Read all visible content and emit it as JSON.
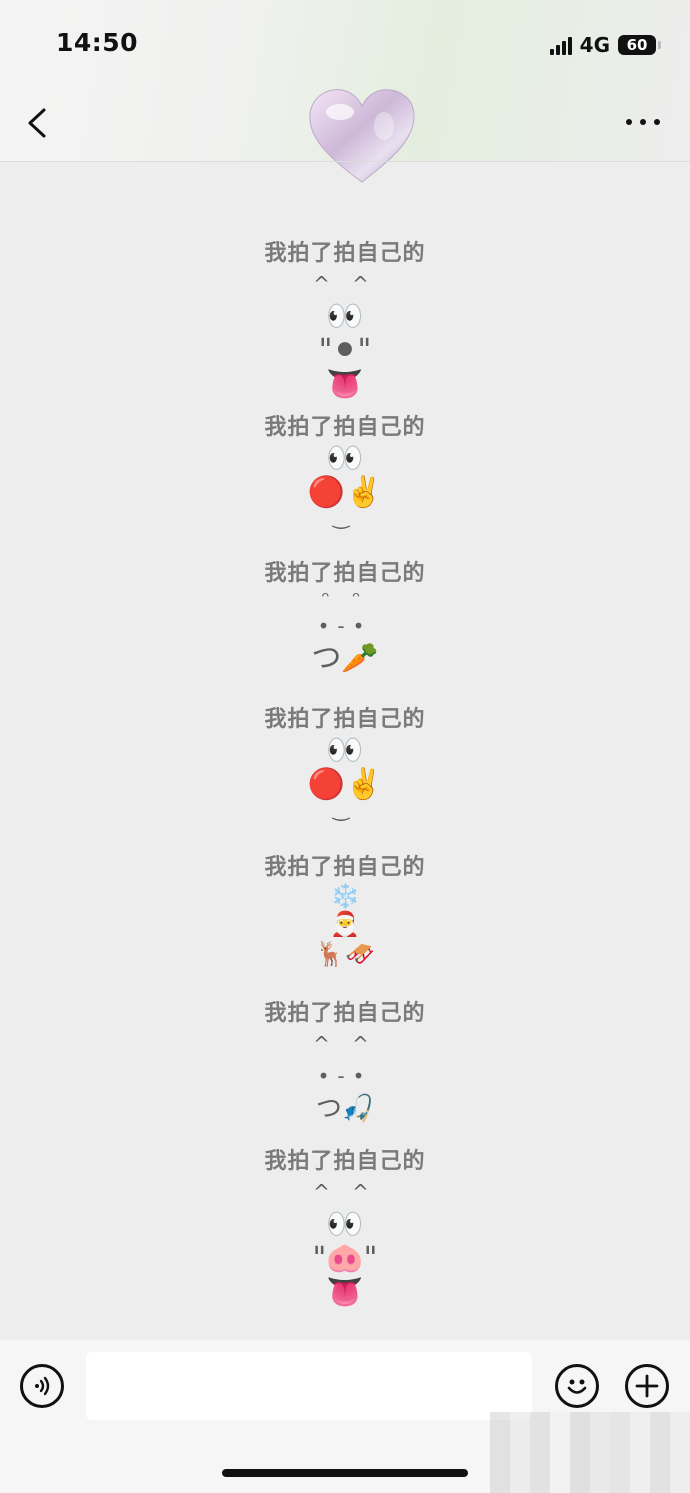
{
  "status_bar": {
    "time": "14:50",
    "network": "4G",
    "battery": "60"
  },
  "header": {
    "back_icon": "chevron-left-icon",
    "more_icon": "more-dots-icon",
    "avatar": "heart-balloon"
  },
  "messages": [
    {
      "text": "我拍了拍自己的",
      "lines": [
        "^ ^",
        "👀",
        "\"⚫\"",
        "👅"
      ]
    },
    {
      "text": "我拍了拍自己的",
      "lines": [
        "👀",
        "🔴✌️",
        "‿"
      ]
    },
    {
      "text": "我拍了拍自己的",
      "lines": [
        "ᵔ ᵔ",
        "•-•",
        "つ🥕"
      ]
    },
    {
      "text": "我拍了拍自己的",
      "lines": [
        "👀",
        "🔴✌️",
        "‿"
      ]
    },
    {
      "text": "我拍了拍自己的",
      "lines": [
        "❄️",
        "🎅",
        "🦌🛷"
      ]
    },
    {
      "text": "我拍了拍自己的",
      "lines": [
        "^ ^",
        "•-•",
        "つ🎣"
      ]
    },
    {
      "text": "我拍了拍自己的",
      "lines": [
        "^ ^",
        "👀",
        "\"🐽\"",
        "👅"
      ]
    }
  ],
  "input_bar": {
    "voice_icon": "voice-icon",
    "emoji_icon": "smiley-icon",
    "plus_icon": "plus-icon",
    "text_value": ""
  }
}
